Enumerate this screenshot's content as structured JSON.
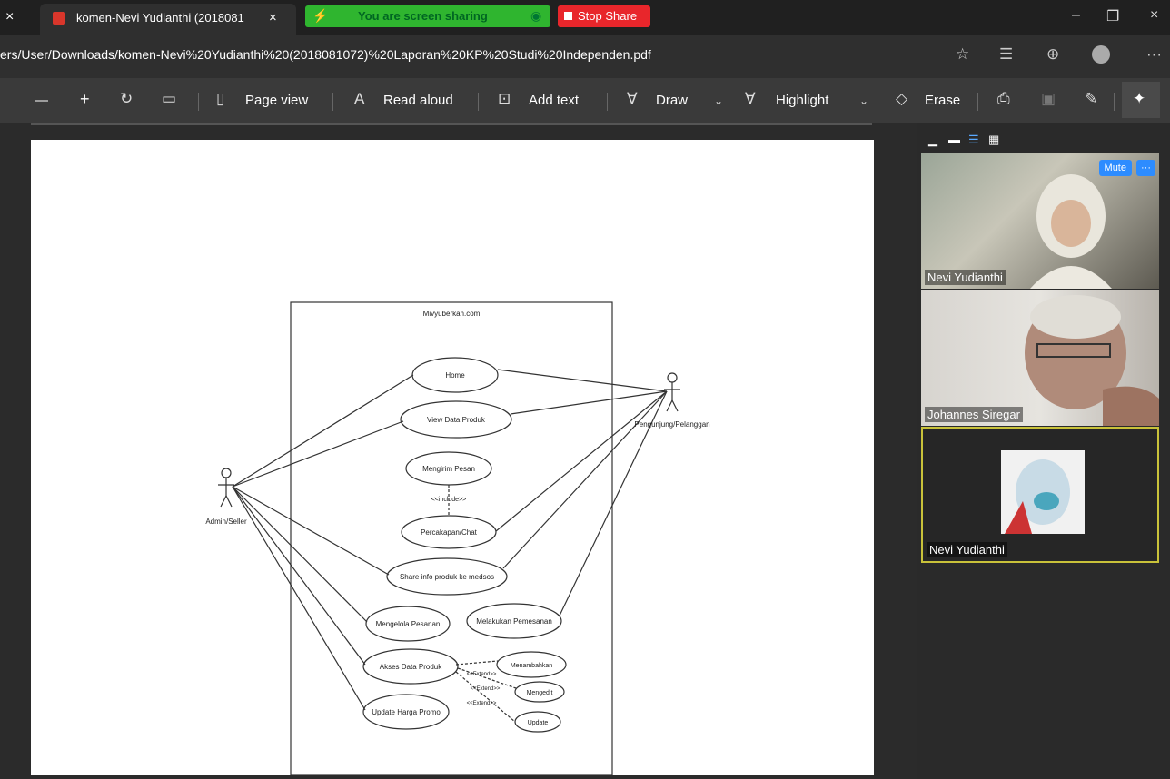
{
  "tab": {
    "close_left": "×",
    "title": "komen-Nevi Yudianthi (2018081",
    "close": "×"
  },
  "sharing": {
    "status": "You are screen sharing",
    "stop_label": "Stop Share"
  },
  "window_controls": {
    "minimize": "–",
    "restore": "❐",
    "close": "×"
  },
  "address": {
    "url": "ers/User/Downloads/komen-Nevi%20Yudianthi%20(2018081072)%20Laporan%20KP%20Studi%20Independen.pdf"
  },
  "toolbar": {
    "zoom_out": "—",
    "zoom_in": "+",
    "page_view": "Page view",
    "read_aloud": "Read aloud",
    "add_text": "Add text",
    "draw": "Draw",
    "highlight": "Highlight",
    "erase": "Erase"
  },
  "diagram": {
    "system": "Mivyuberkah.com",
    "actors": {
      "admin": "Admin/Seller",
      "customer": "Pengunjung/Pelanggan"
    },
    "use_cases": {
      "home": "Home",
      "view_data": "View Data Produk",
      "send_message": "Mengirim Pesan",
      "chat": "Percakapan/Chat",
      "share": "Share info produk ke medsos",
      "manage_orders": "Mengelola Pesanan",
      "place_order": "Melakukan Pemesanan",
      "product_access": "Akses Data Produk",
      "promo": "Update Harga Promo",
      "add": "Menambahkan",
      "edit": "Mengedit",
      "update": "Update"
    },
    "relations": {
      "include": "<<include>>",
      "extend": "<<Extend>>"
    }
  },
  "meeting": {
    "mute_label": "Mute",
    "more_label": "···",
    "participants": [
      {
        "name": "Nevi Yudianthi"
      },
      {
        "name": "Johannes Siregar"
      },
      {
        "name": "Nevi Yudianthi"
      }
    ]
  }
}
